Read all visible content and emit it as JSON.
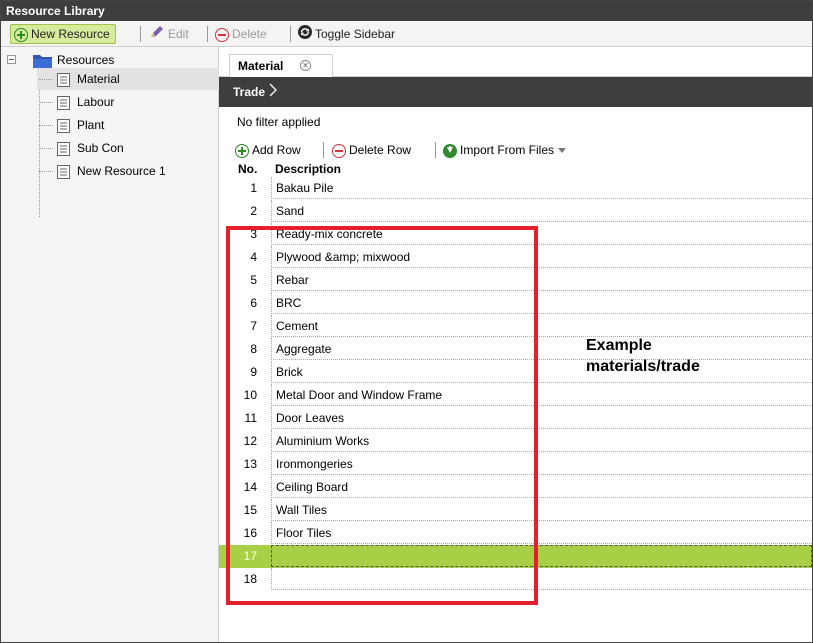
{
  "app": {
    "title": "Resource Library"
  },
  "toolbar": {
    "new_resource": "New Resource",
    "edit": "Edit",
    "delete": "Delete",
    "toggle_sidebar": "Toggle Sidebar"
  },
  "sidebar": {
    "root_label": "Resources",
    "items": [
      {
        "label": "Material"
      },
      {
        "label": "Labour"
      },
      {
        "label": "Plant"
      },
      {
        "label": "Sub Con"
      },
      {
        "label": "New Resource 1"
      }
    ]
  },
  "tabs": [
    {
      "label": "Material"
    }
  ],
  "breadcrumb": {
    "label": "Trade"
  },
  "filter": {
    "status": "No filter applied"
  },
  "grid_tools": {
    "add_row": "Add Row",
    "delete_row": "Delete Row",
    "import": "Import From Files"
  },
  "grid": {
    "columns": {
      "no": "No.",
      "description": "Description"
    },
    "rows": [
      {
        "no": "1",
        "description": "Bakau Pile"
      },
      {
        "no": "2",
        "description": "Sand"
      },
      {
        "no": "3",
        "description": "Ready-mix concrete"
      },
      {
        "no": "4",
        "description": "Plywood &amp; mixwood"
      },
      {
        "no": "5",
        "description": "Rebar"
      },
      {
        "no": "6",
        "description": "BRC"
      },
      {
        "no": "7",
        "description": "Cement"
      },
      {
        "no": "8",
        "description": "Aggregate"
      },
      {
        "no": "9",
        "description": "Brick"
      },
      {
        "no": "10",
        "description": "Metal Door and Window Frame"
      },
      {
        "no": "11",
        "description": "Door Leaves"
      },
      {
        "no": "12",
        "description": "Aluminium Works"
      },
      {
        "no": "13",
        "description": "Ironmongeries"
      },
      {
        "no": "14",
        "description": "Ceiling Board"
      },
      {
        "no": "15",
        "description": "Wall Tiles"
      },
      {
        "no": "16",
        "description": "Floor Tiles"
      },
      {
        "no": "17",
        "description": ""
      },
      {
        "no": "18",
        "description": ""
      }
    ]
  },
  "annotation": {
    "line1": "Example",
    "line2": "materials/trade"
  },
  "colors": {
    "highlight": "#e3202c",
    "active_row": "#a8cf45",
    "header_bar": "#3e3e3e"
  }
}
